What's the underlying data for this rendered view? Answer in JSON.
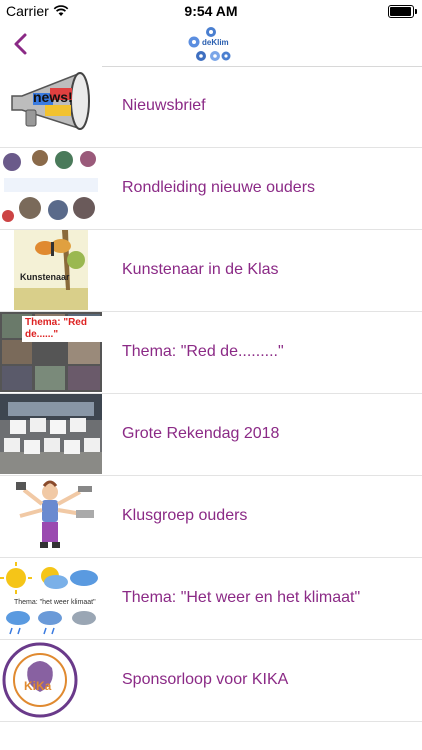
{
  "status": {
    "carrier": "Carrier",
    "time": "9:54 AM",
    "battery_level": 0.95
  },
  "nav": {
    "logo_text": "deKlim"
  },
  "items": [
    {
      "label": "Nieuwsbrief",
      "thumb_text": "news!"
    },
    {
      "label": "Rondleiding nieuwe ouders"
    },
    {
      "label": "Kunstenaar in de Klas",
      "thumb_text": "Kunstenaar"
    },
    {
      "label": "Thema: \"Red de.........\"",
      "thumb_text": "Thema: \"Red de......\""
    },
    {
      "label": "Grote Rekendag 2018"
    },
    {
      "label": "Klusgroep ouders"
    },
    {
      "label": "Thema: \"Het weer en het klimaat\"",
      "thumb_text": "Thema: \"het weer klimaat\""
    },
    {
      "label": "Sponsorloop voor KIKA",
      "thumb_text": "KiKa"
    }
  ],
  "colors": {
    "accent": "#8b2a86",
    "separator": "#e3e3e3"
  }
}
